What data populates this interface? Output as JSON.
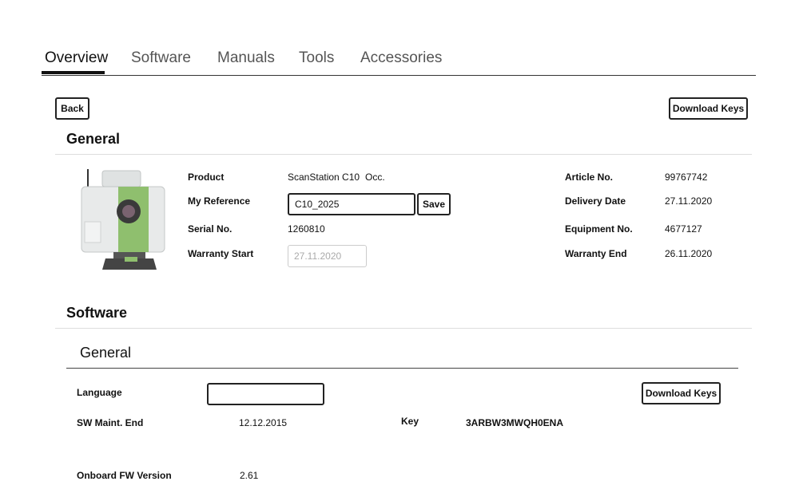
{
  "tabs": [
    {
      "label": "Overview",
      "active": true
    },
    {
      "label": "Software",
      "active": false
    },
    {
      "label": "Manuals",
      "active": false
    },
    {
      "label": "Tools",
      "active": false
    },
    {
      "label": "Accessories",
      "active": false
    }
  ],
  "toolbar": {
    "back_label": "Back",
    "download_keys_label": "Download Keys"
  },
  "general": {
    "title": "General",
    "product_image": "scanstation-c10-image",
    "product": {
      "label": "Product",
      "value": "ScanStation C10",
      "suffix": "Occ."
    },
    "my_reference": {
      "label": "My Reference",
      "value": "C10_2025",
      "save_label": "Save"
    },
    "serial": {
      "label": "Serial No.",
      "value": "1260810"
    },
    "warranty_start": {
      "label": "Warranty Start",
      "value": "27.11.2020"
    },
    "article": {
      "label": "Article No.",
      "value": "99767742"
    },
    "delivery_date": {
      "label": "Delivery Date",
      "value": "27.11.2020"
    },
    "equipment": {
      "label": "Equipment No.",
      "value": "4677127"
    },
    "warranty_end": {
      "label": "Warranty End",
      "value": "26.11.2020"
    }
  },
  "software": {
    "title": "Software",
    "subsection_title": "General",
    "language": {
      "label": "Language",
      "value": ""
    },
    "download_keys_label": "Download Keys",
    "sw_maint_end": {
      "label": "SW Maint. End",
      "value": "12.12.2015"
    },
    "key": {
      "label": "Key",
      "value": "3ARBW3MWQH0ENA"
    },
    "onboard_fw": {
      "label": "Onboard FW Version",
      "value": "2.61"
    }
  },
  "colors": {
    "accent_green": "#8fbf6e",
    "body_gray": "#e9ebea"
  }
}
